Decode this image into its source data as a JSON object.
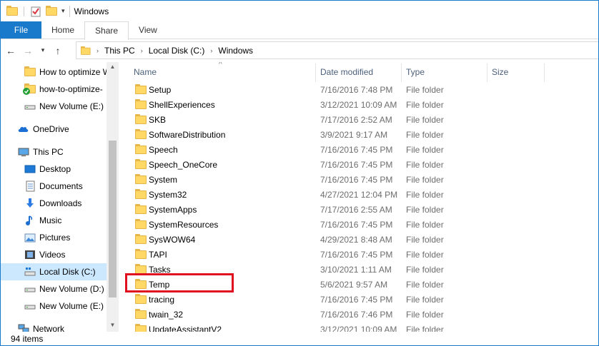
{
  "window": {
    "title": "Windows"
  },
  "ribbon": {
    "tabs": [
      {
        "label": "File"
      },
      {
        "label": "Home"
      },
      {
        "label": "Share"
      },
      {
        "label": "View"
      }
    ]
  },
  "address": {
    "breadcrumb": [
      "This PC",
      "Local Disk (C:)",
      "Windows"
    ]
  },
  "nav_pane": {
    "items": [
      {
        "label": "How to optimize W",
        "icon": "folder-icon"
      },
      {
        "label": "how-to-optimize-",
        "icon": "synced-folder-icon"
      },
      {
        "label": "New Volume (E:)",
        "icon": "drive-icon"
      },
      {
        "label": "OneDrive",
        "icon": "onedrive-icon"
      },
      {
        "label": "This PC",
        "icon": "computer-icon"
      },
      {
        "label": "Desktop",
        "icon": "desktop-icon"
      },
      {
        "label": "Documents",
        "icon": "documents-icon"
      },
      {
        "label": "Downloads",
        "icon": "downloads-icon"
      },
      {
        "label": "Music",
        "icon": "music-icon"
      },
      {
        "label": "Pictures",
        "icon": "pictures-icon"
      },
      {
        "label": "Videos",
        "icon": "videos-icon"
      },
      {
        "label": "Local Disk (C:)",
        "icon": "local-disk-icon",
        "selected": true
      },
      {
        "label": "New Volume (D:)",
        "icon": "drive-icon"
      },
      {
        "label": "New Volume (E:)",
        "icon": "drive-icon"
      },
      {
        "label": "Network",
        "icon": "network-icon"
      }
    ]
  },
  "file_list": {
    "columns": {
      "name": "Name",
      "date": "Date modified",
      "type": "Type",
      "size": "Size"
    },
    "rows": [
      {
        "name": "Setup",
        "date": "7/16/2016 7:48 PM",
        "type": "File folder"
      },
      {
        "name": "ShellExperiences",
        "date": "3/12/2021 10:09 AM",
        "type": "File folder"
      },
      {
        "name": "SKB",
        "date": "7/17/2016 2:52 AM",
        "type": "File folder"
      },
      {
        "name": "SoftwareDistribution",
        "date": "3/9/2021 9:17 AM",
        "type": "File folder"
      },
      {
        "name": "Speech",
        "date": "7/16/2016 7:45 PM",
        "type": "File folder"
      },
      {
        "name": "Speech_OneCore",
        "date": "7/16/2016 7:45 PM",
        "type": "File folder"
      },
      {
        "name": "System",
        "date": "7/16/2016 7:45 PM",
        "type": "File folder"
      },
      {
        "name": "System32",
        "date": "4/27/2021 12:04 PM",
        "type": "File folder"
      },
      {
        "name": "SystemApps",
        "date": "7/17/2016 2:55 AM",
        "type": "File folder"
      },
      {
        "name": "SystemResources",
        "date": "7/16/2016 7:45 PM",
        "type": "File folder"
      },
      {
        "name": "SysWOW64",
        "date": "4/29/2021 8:48 AM",
        "type": "File folder"
      },
      {
        "name": "TAPI",
        "date": "7/16/2016 7:45 PM",
        "type": "File folder"
      },
      {
        "name": "Tasks",
        "date": "3/10/2021 1:11 AM",
        "type": "File folder"
      },
      {
        "name": "Temp",
        "date": "5/6/2021 9:57 AM",
        "type": "File folder"
      },
      {
        "name": "tracing",
        "date": "7/16/2016 7:45 PM",
        "type": "File folder"
      },
      {
        "name": "twain_32",
        "date": "7/16/2016 7:46 PM",
        "type": "File folder"
      },
      {
        "name": "UpdateAssistantV2",
        "date": "3/12/2021 10:09 AM",
        "type": "File folder"
      }
    ]
  },
  "status": {
    "item_count": "94 items"
  },
  "colors": {
    "accent": "#1979ca",
    "highlight": "#e0111f",
    "folder": "#ffd865"
  }
}
